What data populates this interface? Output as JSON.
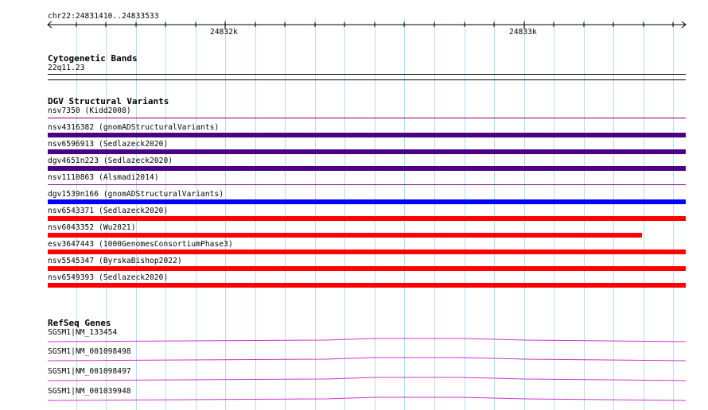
{
  "ruler": {
    "location": "chr22:24831410..24833533",
    "tick_labels": [
      "24832k",
      "24833k"
    ]
  },
  "cytoband": {
    "title": "Cytogenetic Bands",
    "band": "22q11.23"
  },
  "dgv": {
    "title": "DGV Structural Variants",
    "colors": {
      "thin": "#800080",
      "purple": "#4b0082",
      "blue": "#0000ff",
      "red": "#ff0000"
    },
    "variants": [
      {
        "label": "nsv7350 (Kidd2008)",
        "style": "thin"
      },
      {
        "label": "nsv4316382 (gnomADStructuralVariants)",
        "style": "purple"
      },
      {
        "label": "nsv6596913 (Sedlazeck2020)",
        "style": "purple"
      },
      {
        "label": "dgv4651n223 (Sedlazeck2020)",
        "style": "purple"
      },
      {
        "label": "nsv1110863 (Alsmadi2014)",
        "style": "thin"
      },
      {
        "label": "dgv1539n166 (gnomADStructuralVariants)",
        "style": "blue"
      },
      {
        "label": "nsv6543371 (Sedlazeck2020)",
        "style": "red"
      },
      {
        "label": "nsv6043352 (Wu2021)",
        "style": "red",
        "ends_early": true
      },
      {
        "label": "esv3647443 (1000GenomesConsortiumPhase3)",
        "style": "red"
      },
      {
        "label": "nsv5545347 (ByrskaBishop2022)",
        "style": "red"
      },
      {
        "label": "nsv6549393 (Sedlazeck2020)",
        "style": "red"
      }
    ]
  },
  "refseq": {
    "title": "RefSeq Genes",
    "color": "#cc33cc",
    "genes": [
      {
        "label": "SGSM1|NM_133454"
      },
      {
        "label": "SGSM1|NM_001098498"
      },
      {
        "label": "SGSM1|NM_001098497"
      },
      {
        "label": "SGSM1|NM_001039948"
      }
    ]
  }
}
